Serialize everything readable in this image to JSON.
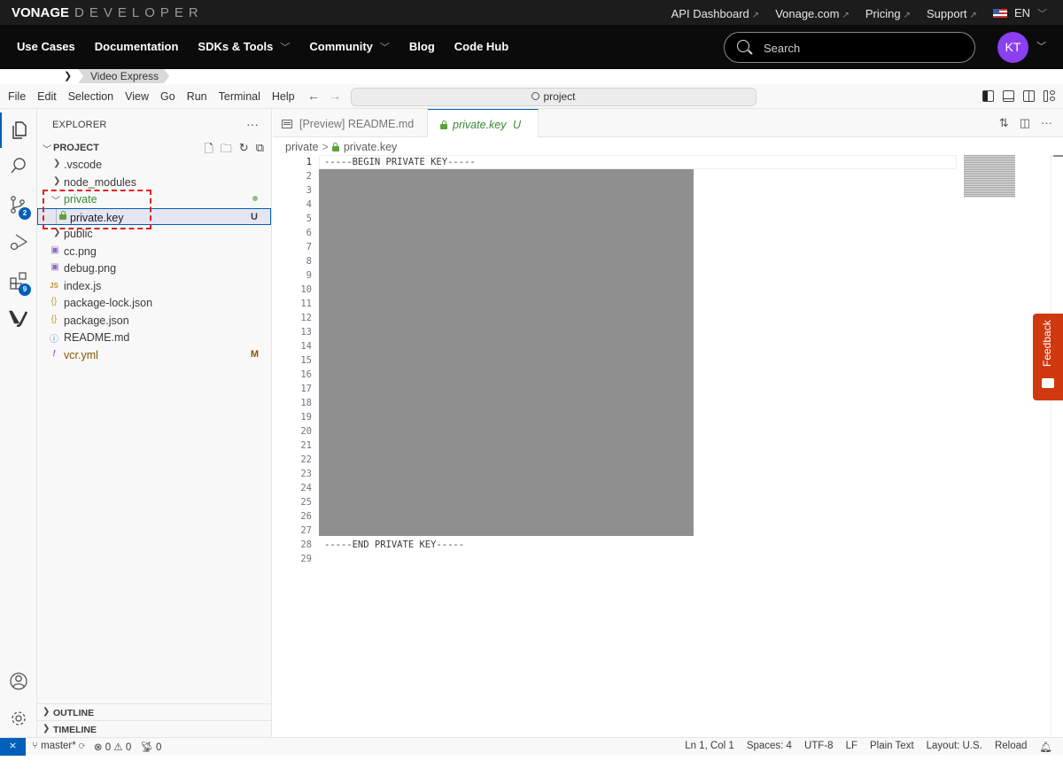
{
  "vonage": {
    "logo_bold": "VONAGE",
    "logo_light": "DEVELOPER",
    "top_links": [
      {
        "label": "API Dashboard",
        "external": true
      },
      {
        "label": "Vonage.com",
        "external": true
      },
      {
        "label": "Pricing",
        "external": true
      },
      {
        "label": "Support",
        "external": true
      }
    ],
    "language": "EN",
    "nav": [
      {
        "label": "Use Cases",
        "dropdown": false
      },
      {
        "label": "Documentation",
        "dropdown": false
      },
      {
        "label": "SDKs & Tools",
        "dropdown": true
      },
      {
        "label": "Community",
        "dropdown": true
      },
      {
        "label": "Blog",
        "dropdown": false
      },
      {
        "label": "Code Hub",
        "dropdown": false
      }
    ],
    "search_placeholder": "Search",
    "avatar_initials": "KT",
    "breadcrumb": "Video Express"
  },
  "vscode": {
    "menu": [
      "File",
      "Edit",
      "Selection",
      "View",
      "Go",
      "Run",
      "Terminal",
      "Help"
    ],
    "command_center": "project",
    "activity_badges": {
      "source_control": "2",
      "extensions": "9"
    },
    "explorer": {
      "title": "EXPLORER",
      "project": "PROJECT",
      "items": [
        {
          "name": ".vscode",
          "type": "folder",
          "expanded": false
        },
        {
          "name": "node_modules",
          "type": "folder",
          "expanded": false
        },
        {
          "name": "private",
          "type": "folder",
          "expanded": true,
          "status": "untracked-dot"
        },
        {
          "name": "private.key",
          "type": "key",
          "status": "U",
          "selected": true
        },
        {
          "name": "public",
          "type": "folder",
          "expanded": false
        },
        {
          "name": "cc.png",
          "type": "image"
        },
        {
          "name": "debug.png",
          "type": "image"
        },
        {
          "name": "index.js",
          "type": "js"
        },
        {
          "name": "package-lock.json",
          "type": "json"
        },
        {
          "name": "package.json",
          "type": "json"
        },
        {
          "name": "README.md",
          "type": "info"
        },
        {
          "name": "vcr.yml",
          "type": "yaml",
          "status": "M"
        }
      ],
      "outline": "OUTLINE",
      "timeline": "TIMELINE"
    },
    "tabs": [
      {
        "label": "[Preview] README.md",
        "active": false
      },
      {
        "label": "private.key",
        "status": "U",
        "active": true
      }
    ],
    "breadcrumbs": [
      "private",
      "private.key"
    ],
    "editor": {
      "line_count": 29,
      "current_line": 1,
      "first_line": "-----BEGIN PRIVATE KEY-----",
      "last_line": "-----END PRIVATE KEY-----",
      "redacted_lines": "2-27"
    },
    "status": {
      "branch": "master*",
      "errors": "0",
      "warnings": "0",
      "ports": "0",
      "position": "Ln 1, Col 1",
      "spaces": "Spaces: 4",
      "encoding": "UTF-8",
      "eol": "LF",
      "language": "Plain Text",
      "layout": "Layout: U.S.",
      "reload": "Reload"
    }
  },
  "feedback_label": "Feedback"
}
